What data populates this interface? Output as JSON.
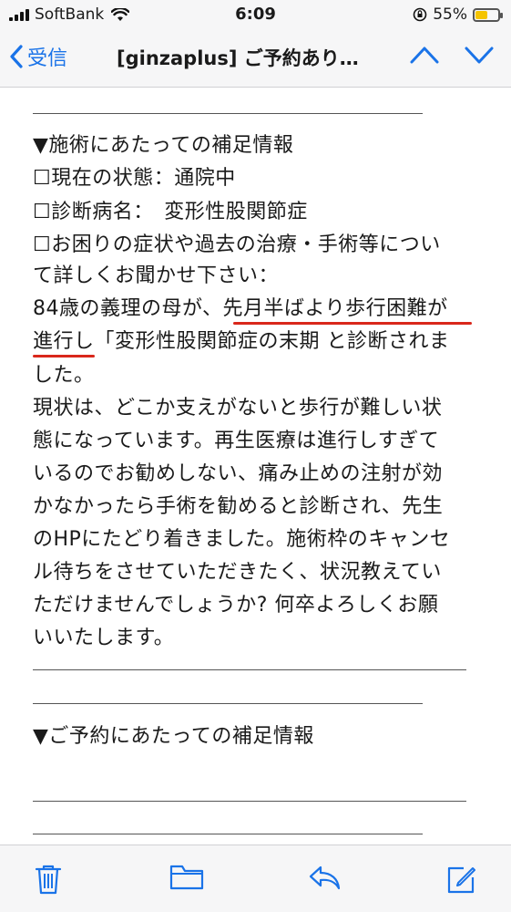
{
  "status": {
    "carrier": "SoftBank",
    "time": "6:09",
    "battery_percent": "55%",
    "battery_level": 0.55
  },
  "nav": {
    "back_label": "受信",
    "title": "[ginzaplus] ご予約あり…"
  },
  "body": {
    "section1_heading": "▼施術にあたっての補足情報",
    "status_line": "☐現在の状態：通院中",
    "diagnosis_line": "☐診断病名：　変形性股関節症",
    "question_line1": "☐お困りの症状や過去の治療・手術等につい",
    "question_line2": "て詳しくお聞かせ下さい：",
    "para1_line1": "84歳の義理の母が、先月半ばより歩行困難が",
    "para1_line2": "進行し「変形性股関節症の末期 と診断されま",
    "para1_line3": "した。",
    "para2_line1": "現状は、どこか支えがないと歩行が難しい状",
    "para2_line2": "態になっています。再生医療は進行しすぎて",
    "para2_line3": "いるのでお勧めしない、痛み止めの注射が効",
    "para2_line4": "かなかったら手術を勧めると診断され、先生",
    "para2_line5": "のHPにたどり着きました。施術枠のキャンセ",
    "para2_line6": "ル待ちをさせていただきたく、状況教えてい",
    "para2_line7": "ただけませんでしょうか? 何卒よろしくお願",
    "para2_line8": "いいたします。",
    "section2_heading": "▼ご予約にあたっての補足情報"
  },
  "colors": {
    "accent": "#1a73e8",
    "highlight_underline": "#d9271b",
    "battery": "#f5c400"
  },
  "toolbar": {
    "icons": [
      "trash-icon",
      "folder-icon",
      "reply-icon",
      "compose-icon"
    ]
  }
}
